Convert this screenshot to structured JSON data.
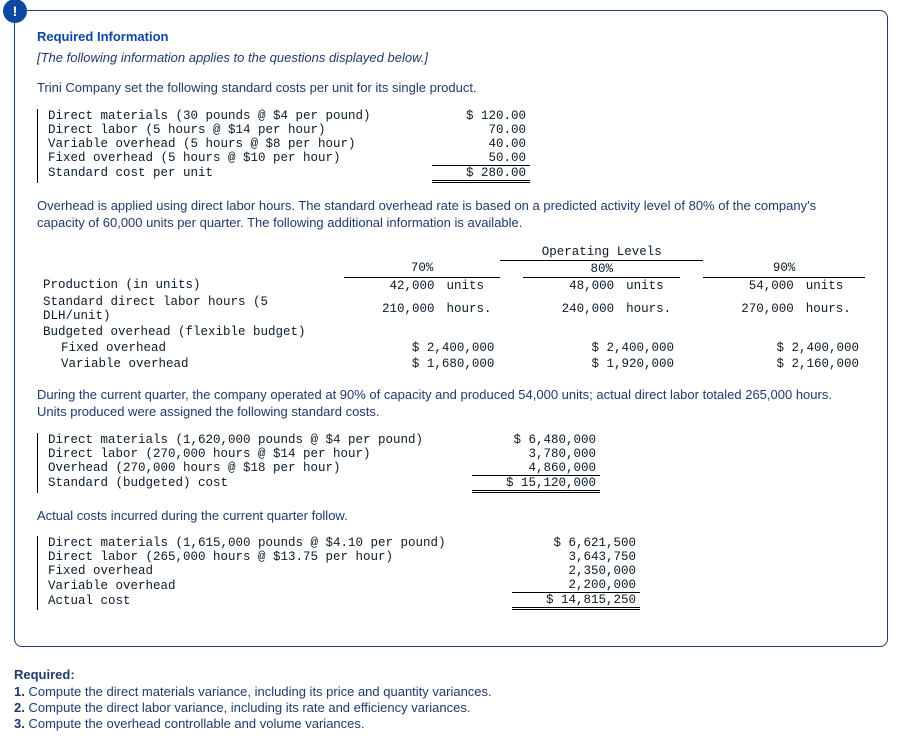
{
  "header": {
    "title": "Required Information",
    "note": "[The following information applies to the questions displayed below.]",
    "intro": "Trini Company set the following standard costs per unit for its single product."
  },
  "std": {
    "r1": {
      "label": "Direct materials (30 pounds @ $4 per pound)",
      "val": "$ 120.00"
    },
    "r2": {
      "label": "Direct labor (5 hours @ $14 per hour)",
      "val": "70.00"
    },
    "r3": {
      "label": "Variable overhead (5 hours @ $8 per hour)",
      "val": "40.00"
    },
    "r4": {
      "label": "Fixed overhead (5 hours @ $10 per hour)",
      "val": "50.00"
    },
    "tot": {
      "label": "Standard cost per unit",
      "val": "$ 280.00"
    }
  },
  "para1": "Overhead is applied using direct labor hours. The standard overhead rate is based on a predicted activity level of 80% of the company's capacity of 60,000 units per quarter. The following additional information is available.",
  "op": {
    "title": "Operating Levels",
    "h70": "70%",
    "h80": "80%",
    "h90": "90%",
    "row_prod": {
      "label": "Production (in units)",
      "c70": "42,000",
      "u70": "units",
      "c80": "48,000",
      "u80": "units",
      "c90": "54,000",
      "u90": "units"
    },
    "row_dlh": {
      "label": "Standard direct labor hours (5 DLH/unit)",
      "c70": "210,000",
      "u70": "hours.",
      "c80": "240,000",
      "u80": "hours.",
      "c90": "270,000",
      "u90": "hours."
    },
    "row_bud": {
      "label": "Budgeted overhead (flexible budget)"
    },
    "row_fix": {
      "label": "Fixed overhead",
      "c70": "$ 2,400,000",
      "c80": "$ 2,400,000",
      "c90": "$ 2,400,000"
    },
    "row_var": {
      "label": "Variable overhead",
      "c70": "$ 1,680,000",
      "c80": "$ 1,920,000",
      "c90": "$ 2,160,000"
    }
  },
  "para2": "During the current quarter, the company operated at 90% of capacity and produced 54,000 units; actual direct labor totaled 265,000 hours. Units produced were assigned the following standard costs.",
  "budget": {
    "r1": {
      "label": "Direct materials (1,620,000 pounds @ $4 per pound)",
      "val": "$ 6,480,000"
    },
    "r2": {
      "label": "Direct labor (270,000 hours @ $14 per hour)",
      "val": "3,780,000"
    },
    "r3": {
      "label": "Overhead (270,000 hours @ $18 per hour)",
      "val": "4,860,000"
    },
    "tot": {
      "label": "Standard (budgeted) cost",
      "val": "$ 15,120,000"
    }
  },
  "para3": "Actual costs incurred during the current quarter follow.",
  "actual": {
    "r1": {
      "label": "Direct materials (1,615,000 pounds @ $4.10 per pound)",
      "val": "$ 6,621,500"
    },
    "r2": {
      "label": "Direct labor (265,000 hours @ $13.75 per hour)",
      "val": "3,643,750"
    },
    "r3": {
      "label": "Fixed overhead",
      "val": "2,350,000"
    },
    "r4": {
      "label": "Variable overhead",
      "val": "2,200,000"
    },
    "tot": {
      "label": "Actual cost",
      "val": "$ 14,815,250"
    }
  },
  "required": {
    "title": "Required:",
    "i1": "Compute the direct materials variance, including its price and quantity variances.",
    "i2": "Compute the direct labor variance, including its rate and efficiency variances.",
    "i3": "Compute the overhead controllable and volume variances."
  }
}
